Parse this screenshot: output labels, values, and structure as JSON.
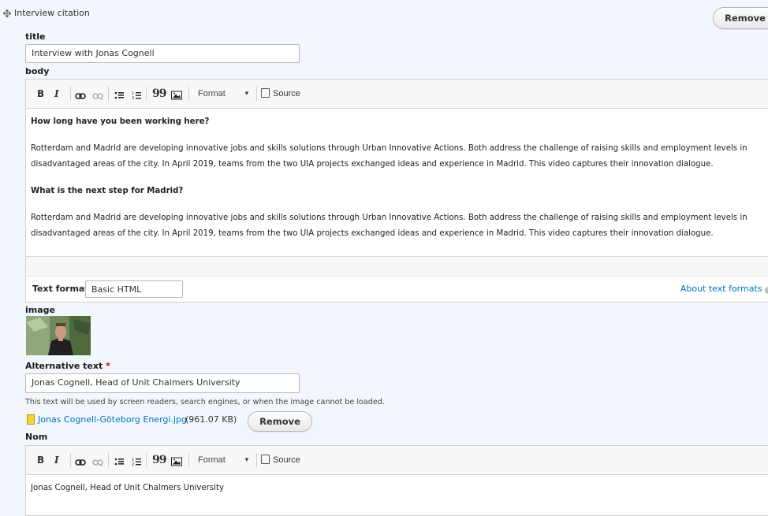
{
  "paragraph": {
    "type_label": "Interview citation",
    "remove_label": "Remove"
  },
  "title_field": {
    "label": "title",
    "value": "Interview with Jonas Cognell"
  },
  "body_field": {
    "label": "body",
    "toolbar": {
      "bold": "B",
      "italic": "I",
      "link": "link-icon",
      "unlink": "unlink-icon",
      "bulleted_list": "bulleted-list-icon",
      "numbered_list": "numbered-list-icon",
      "blockquote": "99",
      "image": "image-icon",
      "format_label": "Format",
      "source_label": "Source"
    },
    "content": {
      "q1": "How long have you been working here?",
      "p1": "Rotterdam and Madrid are developing innovative jobs and skills solutions through Urban Innovative Actions. Both address the challenge of raising skills and employment levels in disadvantaged areas of the city. In April 2019, teams from the two UIA projects exchanged ideas and experience in Madrid. This video captures their innovation dialogue.",
      "q2": "What is the next step for Madrid?",
      "p2": "Rotterdam and Madrid are developing innovative jobs and skills solutions through Urban Innovative Actions. Both address the challenge of raising skills and employment levels in disadvantaged areas of the city. In April 2019, teams from the two UIA projects exchanged ideas and experience in Madrid. This video captures their innovation dialogue."
    },
    "text_format": {
      "label": "Text format",
      "selected": "Basic HTML",
      "help_link": "About text formats"
    }
  },
  "image_field": {
    "label": "image",
    "alt_label": "Alternative text",
    "required_marker": "*",
    "alt_value": "Jonas Cognell, Head of Unit Chalmers University",
    "description": "This text will be used by screen readers, search engines, or when the image cannot be loaded.",
    "file_name": "Jonas Cognell-Göteborg Energi.jpg",
    "file_size": "(961.07 KB)",
    "remove_label": "Remove"
  },
  "nom_field": {
    "label": "Nom",
    "toolbar": {
      "bold": "B",
      "italic": "I",
      "blockquote": "99",
      "format_label": "Format",
      "source_label": "Source"
    },
    "content": "Jonas Cognell, Head of Unit Chalmers University"
  },
  "colors": {
    "background": "#f1f7fc",
    "link": "#0074bd",
    "required": "#cc0000"
  }
}
